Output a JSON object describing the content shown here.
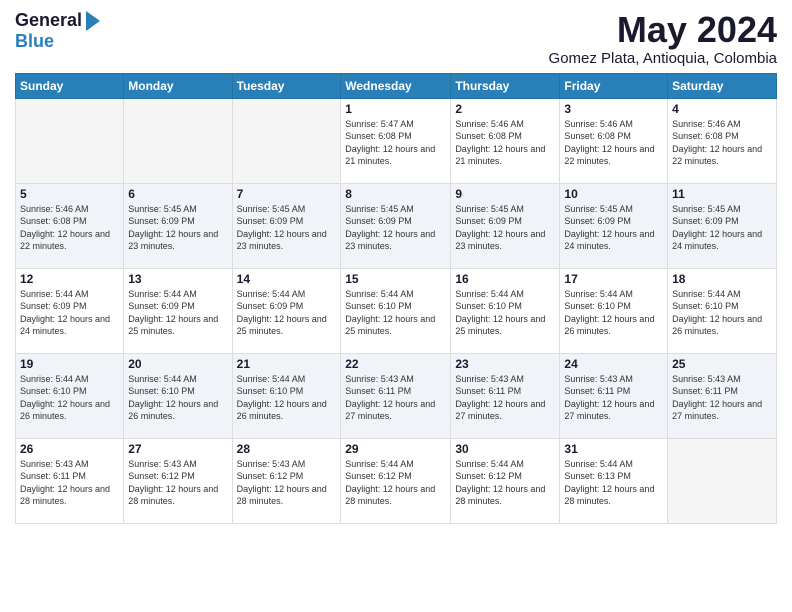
{
  "logo": {
    "general": "General",
    "blue": "Blue"
  },
  "header": {
    "month": "May 2024",
    "location": "Gomez Plata, Antioquia, Colombia"
  },
  "weekdays": [
    "Sunday",
    "Monday",
    "Tuesday",
    "Wednesday",
    "Thursday",
    "Friday",
    "Saturday"
  ],
  "weeks": [
    [
      {
        "day": "",
        "info": ""
      },
      {
        "day": "",
        "info": ""
      },
      {
        "day": "",
        "info": ""
      },
      {
        "day": "1",
        "info": "Sunrise: 5:47 AM\nSunset: 6:08 PM\nDaylight: 12 hours\nand 21 minutes."
      },
      {
        "day": "2",
        "info": "Sunrise: 5:46 AM\nSunset: 6:08 PM\nDaylight: 12 hours\nand 21 minutes."
      },
      {
        "day": "3",
        "info": "Sunrise: 5:46 AM\nSunset: 6:08 PM\nDaylight: 12 hours\nand 22 minutes."
      },
      {
        "day": "4",
        "info": "Sunrise: 5:46 AM\nSunset: 6:08 PM\nDaylight: 12 hours\nand 22 minutes."
      }
    ],
    [
      {
        "day": "5",
        "info": "Sunrise: 5:46 AM\nSunset: 6:08 PM\nDaylight: 12 hours\nand 22 minutes."
      },
      {
        "day": "6",
        "info": "Sunrise: 5:45 AM\nSunset: 6:09 PM\nDaylight: 12 hours\nand 23 minutes."
      },
      {
        "day": "7",
        "info": "Sunrise: 5:45 AM\nSunset: 6:09 PM\nDaylight: 12 hours\nand 23 minutes."
      },
      {
        "day": "8",
        "info": "Sunrise: 5:45 AM\nSunset: 6:09 PM\nDaylight: 12 hours\nand 23 minutes."
      },
      {
        "day": "9",
        "info": "Sunrise: 5:45 AM\nSunset: 6:09 PM\nDaylight: 12 hours\nand 23 minutes."
      },
      {
        "day": "10",
        "info": "Sunrise: 5:45 AM\nSunset: 6:09 PM\nDaylight: 12 hours\nand 24 minutes."
      },
      {
        "day": "11",
        "info": "Sunrise: 5:45 AM\nSunset: 6:09 PM\nDaylight: 12 hours\nand 24 minutes."
      }
    ],
    [
      {
        "day": "12",
        "info": "Sunrise: 5:44 AM\nSunset: 6:09 PM\nDaylight: 12 hours\nand 24 minutes."
      },
      {
        "day": "13",
        "info": "Sunrise: 5:44 AM\nSunset: 6:09 PM\nDaylight: 12 hours\nand 25 minutes."
      },
      {
        "day": "14",
        "info": "Sunrise: 5:44 AM\nSunset: 6:09 PM\nDaylight: 12 hours\nand 25 minutes."
      },
      {
        "day": "15",
        "info": "Sunrise: 5:44 AM\nSunset: 6:10 PM\nDaylight: 12 hours\nand 25 minutes."
      },
      {
        "day": "16",
        "info": "Sunrise: 5:44 AM\nSunset: 6:10 PM\nDaylight: 12 hours\nand 25 minutes."
      },
      {
        "day": "17",
        "info": "Sunrise: 5:44 AM\nSunset: 6:10 PM\nDaylight: 12 hours\nand 26 minutes."
      },
      {
        "day": "18",
        "info": "Sunrise: 5:44 AM\nSunset: 6:10 PM\nDaylight: 12 hours\nand 26 minutes."
      }
    ],
    [
      {
        "day": "19",
        "info": "Sunrise: 5:44 AM\nSunset: 6:10 PM\nDaylight: 12 hours\nand 26 minutes."
      },
      {
        "day": "20",
        "info": "Sunrise: 5:44 AM\nSunset: 6:10 PM\nDaylight: 12 hours\nand 26 minutes."
      },
      {
        "day": "21",
        "info": "Sunrise: 5:44 AM\nSunset: 6:10 PM\nDaylight: 12 hours\nand 26 minutes."
      },
      {
        "day": "22",
        "info": "Sunrise: 5:43 AM\nSunset: 6:11 PM\nDaylight: 12 hours\nand 27 minutes."
      },
      {
        "day": "23",
        "info": "Sunrise: 5:43 AM\nSunset: 6:11 PM\nDaylight: 12 hours\nand 27 minutes."
      },
      {
        "day": "24",
        "info": "Sunrise: 5:43 AM\nSunset: 6:11 PM\nDaylight: 12 hours\nand 27 minutes."
      },
      {
        "day": "25",
        "info": "Sunrise: 5:43 AM\nSunset: 6:11 PM\nDaylight: 12 hours\nand 27 minutes."
      }
    ],
    [
      {
        "day": "26",
        "info": "Sunrise: 5:43 AM\nSunset: 6:11 PM\nDaylight: 12 hours\nand 28 minutes."
      },
      {
        "day": "27",
        "info": "Sunrise: 5:43 AM\nSunset: 6:12 PM\nDaylight: 12 hours\nand 28 minutes."
      },
      {
        "day": "28",
        "info": "Sunrise: 5:43 AM\nSunset: 6:12 PM\nDaylight: 12 hours\nand 28 minutes."
      },
      {
        "day": "29",
        "info": "Sunrise: 5:44 AM\nSunset: 6:12 PM\nDaylight: 12 hours\nand 28 minutes."
      },
      {
        "day": "30",
        "info": "Sunrise: 5:44 AM\nSunset: 6:12 PM\nDaylight: 12 hours\nand 28 minutes."
      },
      {
        "day": "31",
        "info": "Sunrise: 5:44 AM\nSunset: 6:13 PM\nDaylight: 12 hours\nand 28 minutes."
      },
      {
        "day": "",
        "info": ""
      }
    ]
  ]
}
